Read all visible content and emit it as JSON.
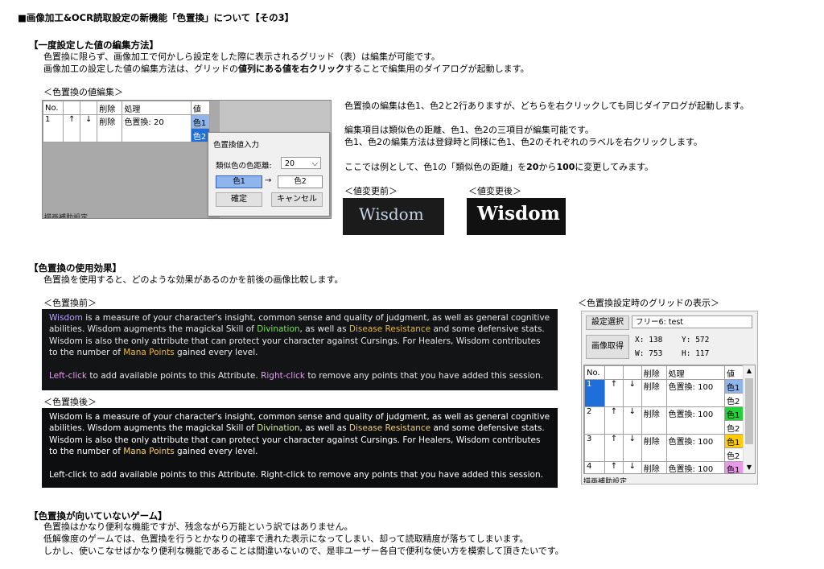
{
  "title": "■画像加工&OCR読取設定の新機能「色置換」について【その3】",
  "edit": {
    "heading": "【一度設定した値の編集方法】",
    "line1": "色置換に限らず、画像加工で何かしら設定をした際に表示されるグリッド（表）は編集が可能です。",
    "line2_a": "画像加工の設定した値の編集方法は、グリッドの",
    "line2_b": "値列にある値を右クリック",
    "line2_c": "することで編集用のダイアログが起動します。",
    "caption": "＜色置換の値編集＞",
    "grid": {
      "headers": [
        "No.",
        "",
        "",
        "削除",
        "処理",
        "値"
      ],
      "row_no": "1",
      "up": "↑",
      "down": "↓",
      "del": "削除",
      "proc": "色置換: 20",
      "val1": "色1",
      "val2": "色2"
    },
    "footer_partial": "描画補助設定",
    "dialog": {
      "title": "色置換値入力",
      "dist_label": "類似色の色距離:",
      "dist_value": "20",
      "color1": "色1",
      "arrow": "→",
      "color2": "色2",
      "ok": "確定",
      "cancel": "キャンセル"
    },
    "desc1": "色置換の編集は色1、色2と2行ありますが、どちらを右クリックしても同じダイアログが起動します。",
    "desc2": "編集項目は類似色の距離、色1、色2の三項目が編集可能です。",
    "desc3": "色1、色2の編集方法は登録時と同様に色1、色2のそれぞれのラベルを右クリックします。",
    "desc4_a": "ここでは例として、色1の「類似色の距離」を",
    "desc4_b": "20",
    "desc4_c": "から",
    "desc4_d": "100",
    "desc4_e": "に変更してみます。",
    "before_caption": "＜値変更前＞",
    "after_caption": "＜値変更後＞",
    "wisdom_before": "Wisdom",
    "wisdom_after": "Wisdom"
  },
  "effect": {
    "heading": "【色置換の使用効果】",
    "line1": "色置換を使用すると、どのような効果があるのかを前後の画像比較します。",
    "before_caption": "＜色置換前＞",
    "after_caption": "＜色置換後＞",
    "game": {
      "w1": "Wisdom",
      "p1a": " is a measure of your character's insight, common sense and quality of judgment, as well as general cognitive abilities. Wisdom augments the magickal Skill of ",
      "div": "Divination",
      "p1b": ", as well as ",
      "dis": "Disease Resistance",
      "p1c": " and some defensive stats. Wisdom is also the only attribute that can protect your character against Cursings. For Healers, Wisdom contributes to the number of ",
      "mana": "Mana Points",
      "p1d": " gained every level.",
      "lclick": "Left-click",
      "p2a": " to add available points to this Attribute. ",
      "rclick": "Right-click",
      "p2b": " to remove any points that you have added this session."
    },
    "grid_caption": "＜色置換設定時のグリッドの表示＞",
    "panel": {
      "select_btn": "設定選択",
      "profile": "フリー6: test",
      "capture_btn": "画像取得",
      "x_label": "X:",
      "x_val": "138",
      "y_label": "Y:",
      "y_val": "572",
      "w_label": "W:",
      "w_val": "753",
      "h_label": "H:",
      "h_val": "117",
      "headers": [
        "No.",
        "",
        "",
        "削除",
        "処理",
        "値"
      ],
      "rows": [
        {
          "no": "1",
          "proc": "色置換: 100",
          "c1": "色1",
          "c2": "色2"
        },
        {
          "no": "2",
          "proc": "色置換: 100",
          "c1": "色1",
          "c2": "色2"
        },
        {
          "no": "3",
          "proc": "色置換: 100",
          "c1": "色1",
          "c2": "色2"
        },
        {
          "no": "4",
          "proc": "色置換: 100",
          "c1": "色1",
          "c2": ""
        }
      ],
      "up": "↑",
      "down": "↓",
      "del": "削除",
      "footer": "描画補助設定"
    }
  },
  "unsuited": {
    "heading": "【色置換が向いていないゲーム】",
    "line1": "色置換はかなり便利な機能ですが、残念ながら万能という訳ではありません。",
    "line2": "低解像度のゲームでは、色置換を行うとかなりの確率で潰れた表示になってしまい、却って読取精度が落ちてしまいます。",
    "line3": "しかし、使いこなせばかなり便利な機能であることは間違いないので、是非ユーザー各自で便利な使い方を模索して頂きたいです。"
  }
}
